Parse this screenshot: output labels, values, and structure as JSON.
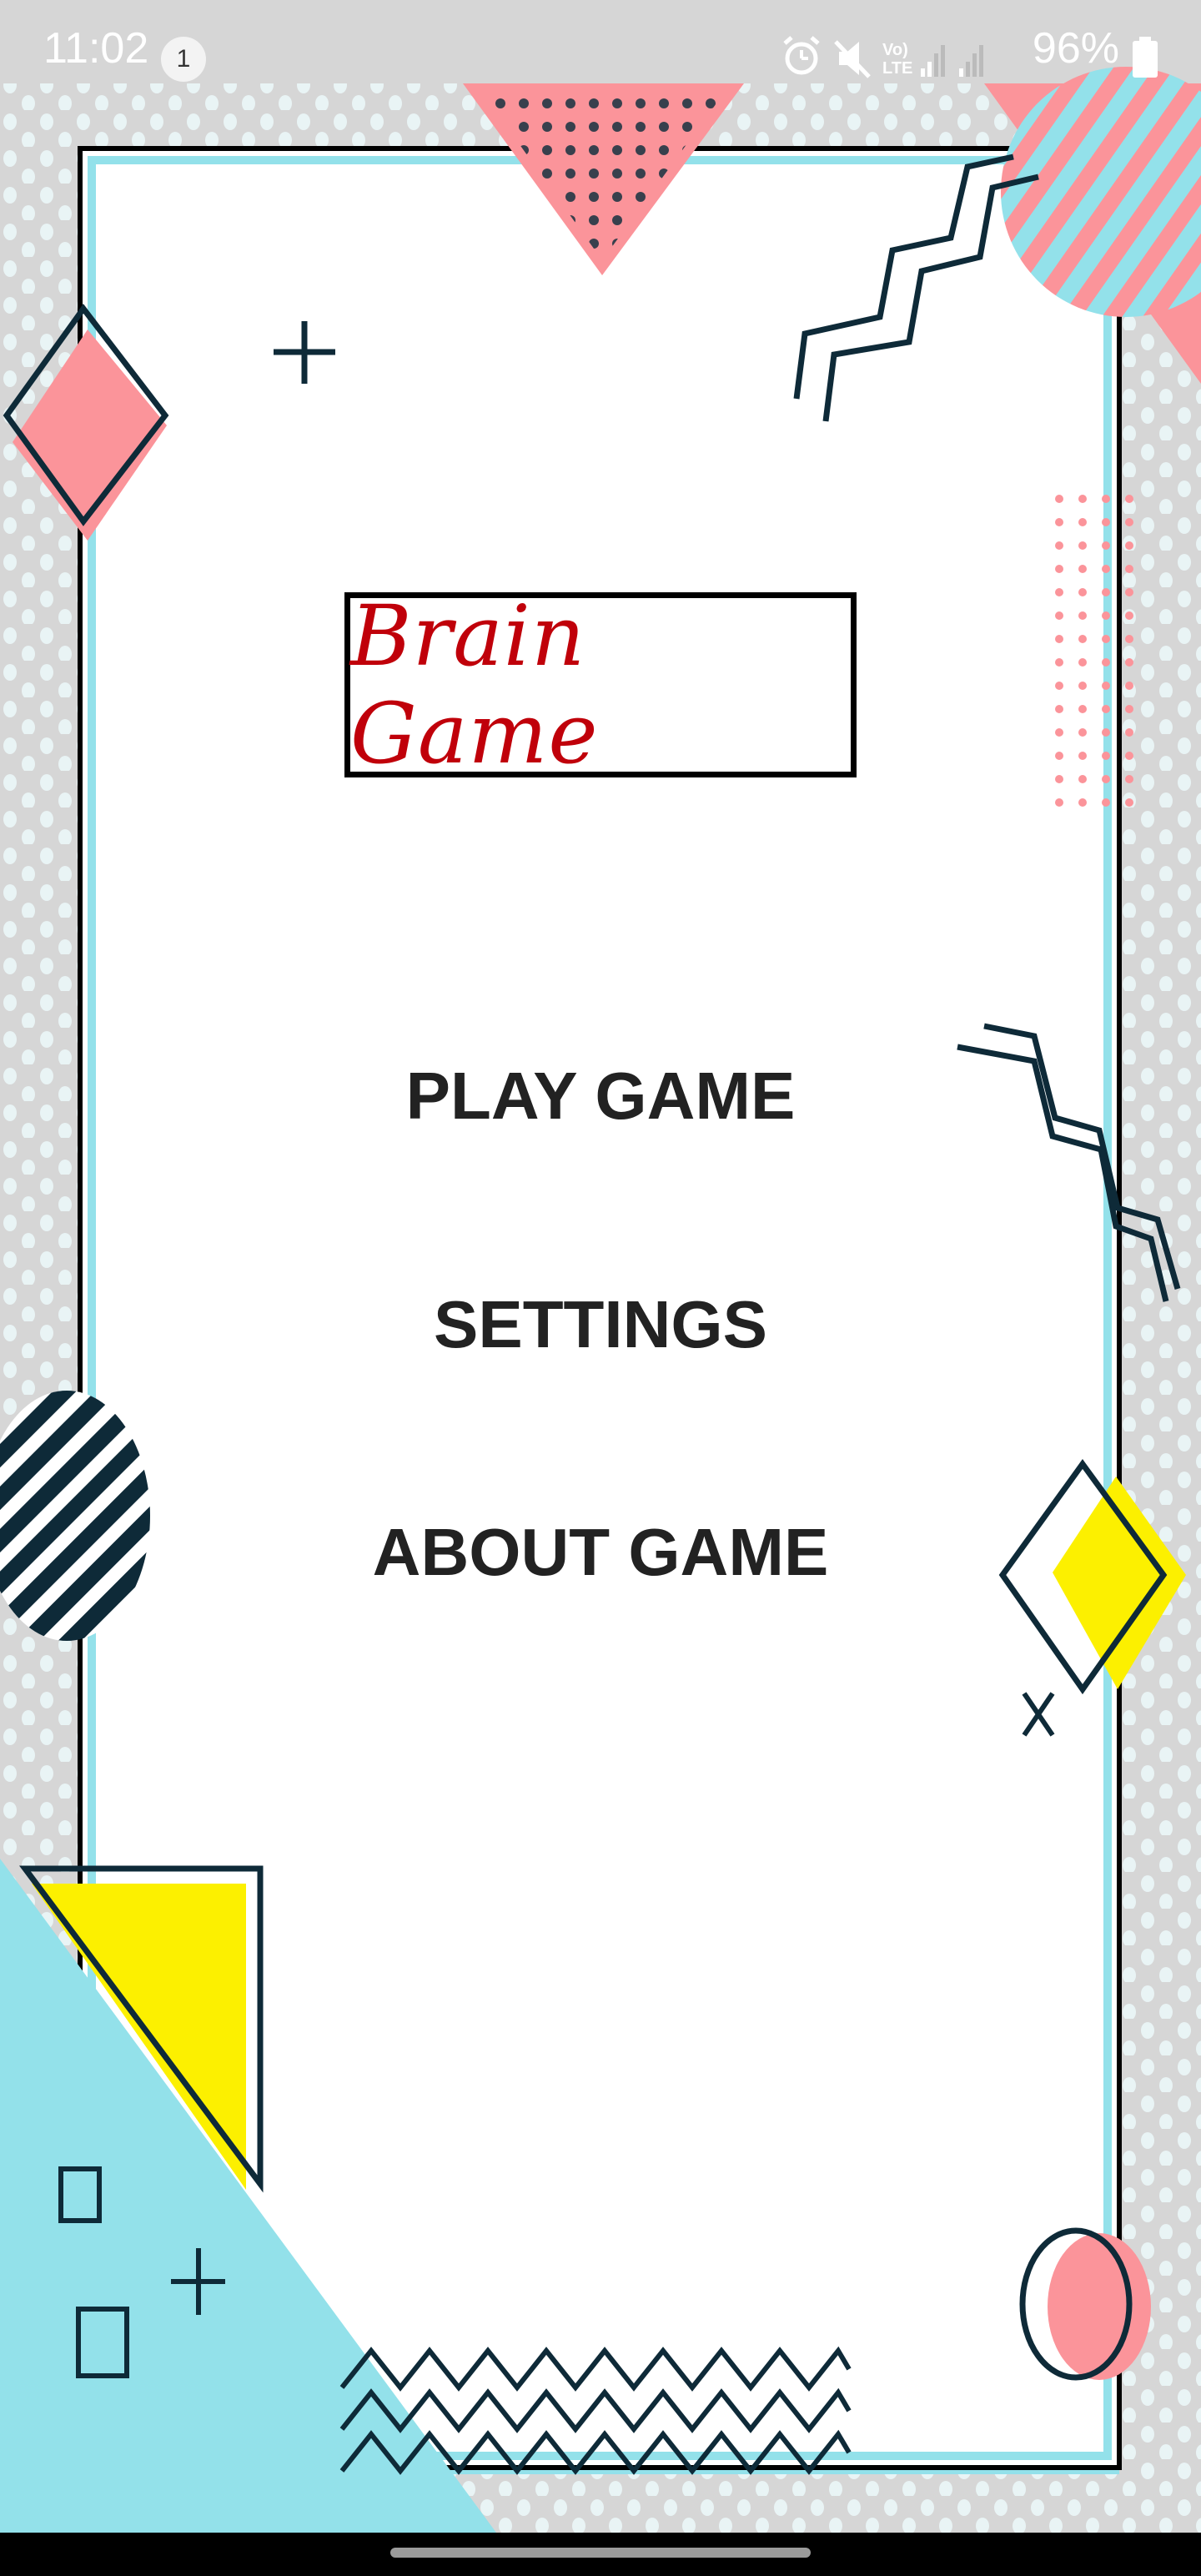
{
  "status_bar": {
    "time": "11:02",
    "notification_count": "1",
    "battery": "96%",
    "icons": [
      "alarm-icon",
      "mute-icon",
      "volte-icon",
      "signal-icon",
      "signal-icon",
      "battery-icon"
    ]
  },
  "app": {
    "title": "Brain Game"
  },
  "menu": {
    "items": [
      "PLAY GAME",
      "SETTINGS",
      "ABOUT GAME"
    ]
  },
  "colors": {
    "pink": "#fb949a",
    "cyan": "#93e1ea",
    "yellow": "#fcf000",
    "navy": "#0e2a38",
    "title_red": "#c0000a"
  }
}
